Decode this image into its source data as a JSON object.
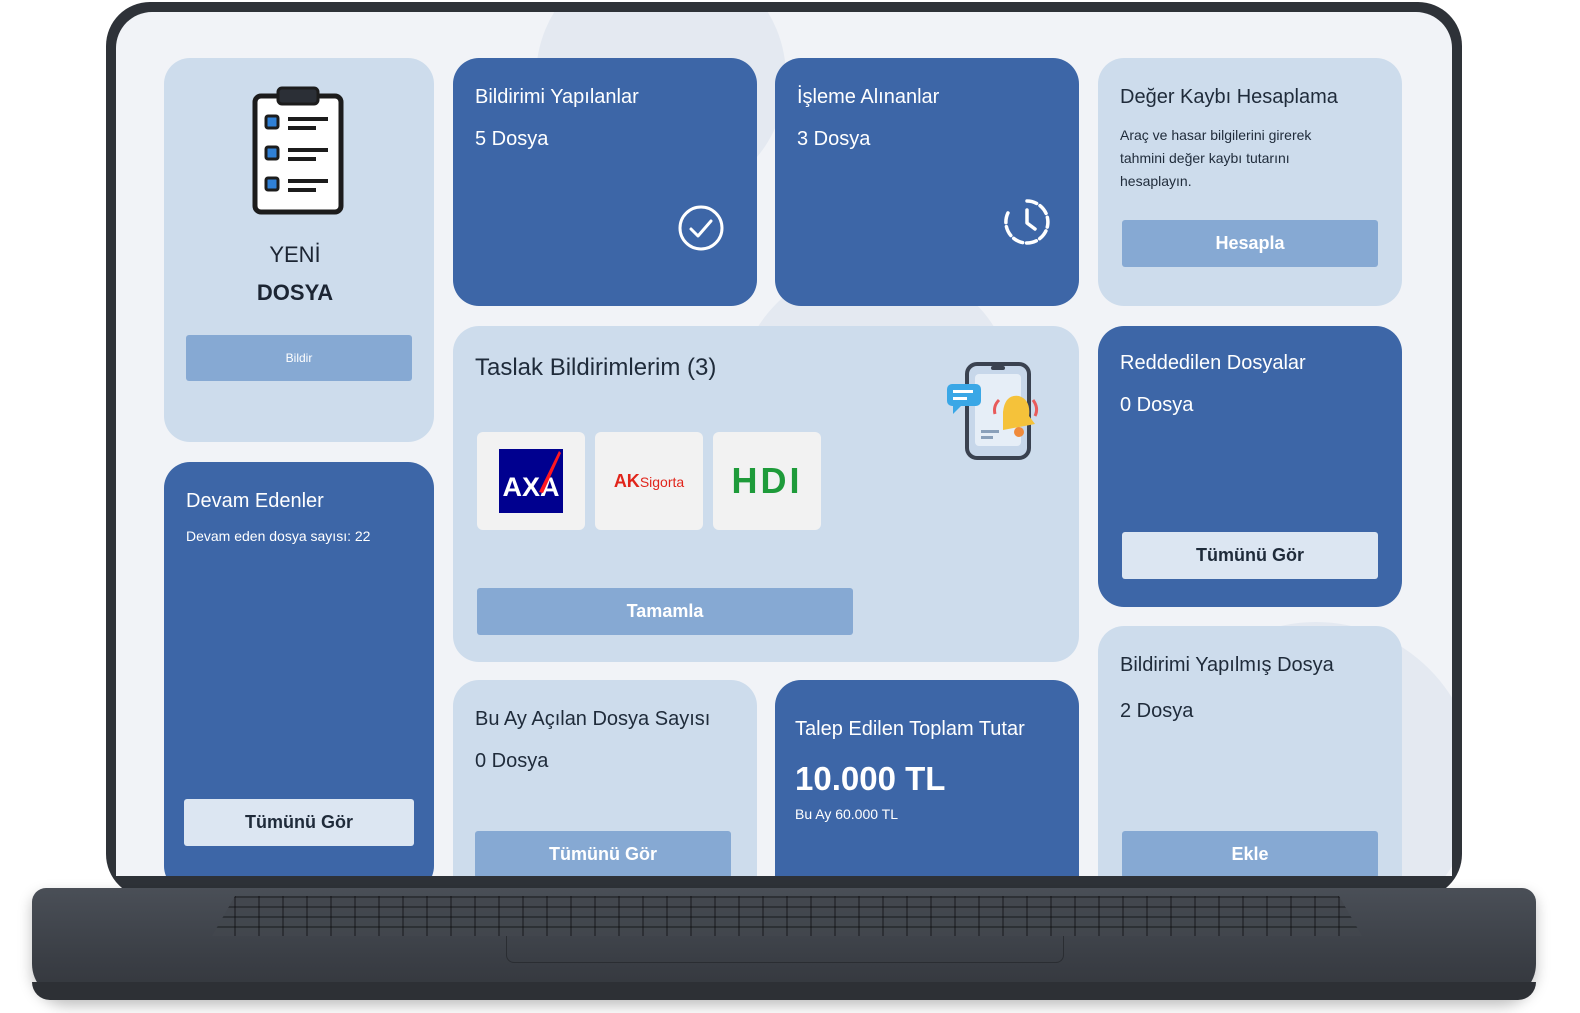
{
  "new_file": {
    "line1": "YENİ",
    "line2": "DOSYA",
    "button_label": "Bildir",
    "icon": "clipboard-checklist-icon"
  },
  "reported": {
    "title": "Bildirimi Yapılanlar",
    "count": "5 Dosya",
    "icon": "check-circle-icon"
  },
  "in_process": {
    "title": "İşleme Alınanlar",
    "count": "3 Dosya",
    "icon": "clock-icon"
  },
  "depreciation": {
    "title": "Değer Kaybı Hesaplama",
    "description": "Araç ve hasar bilgilerini girerek tahmini değer kaybı tutarını hesaplayın.",
    "button_label": "Hesapla"
  },
  "ongoing": {
    "title": "Devam Edenler",
    "description": "Devam eden dosya sayısı: 22",
    "button_label": "Tümünü Gör"
  },
  "drafts": {
    "title": "Taslak Bildirimlerim (3)",
    "button_label": "Tamamla",
    "icon": "phone-notification-icon",
    "logos": [
      {
        "name": "AXA",
        "text": "AXA"
      },
      {
        "name": "AKSigorta",
        "text_a": "AK",
        "text_b": "Sigorta"
      },
      {
        "name": "HDI",
        "text": "HDI"
      }
    ]
  },
  "rejected": {
    "title": "Reddedilen Dosyalar",
    "count": "0 Dosya",
    "button_label": "Tümünü Gör"
  },
  "monthly_opened": {
    "title": "Bu Ay Açılan Dosya Sayısı",
    "count": "0 Dosya",
    "button_label": "Tümünü Gör"
  },
  "requested_total": {
    "title": "Talep Edilen Toplam Tutar",
    "amount": "10.000 TL",
    "monthly": "Bu Ay 60.000 TL"
  },
  "reported_file": {
    "title": "Bildirimi Yapılmış Dosya",
    "count": "2 Dosya",
    "button_label": "Ekle"
  },
  "colors": {
    "dark_card": "#3d66a7",
    "light_card": "#cddcec",
    "button": "#86a9d3",
    "axa_blue": "#00008f",
    "axa_red": "#ff1721",
    "ak_red": "#e1251b",
    "hdi_green": "#1e9b3a"
  }
}
